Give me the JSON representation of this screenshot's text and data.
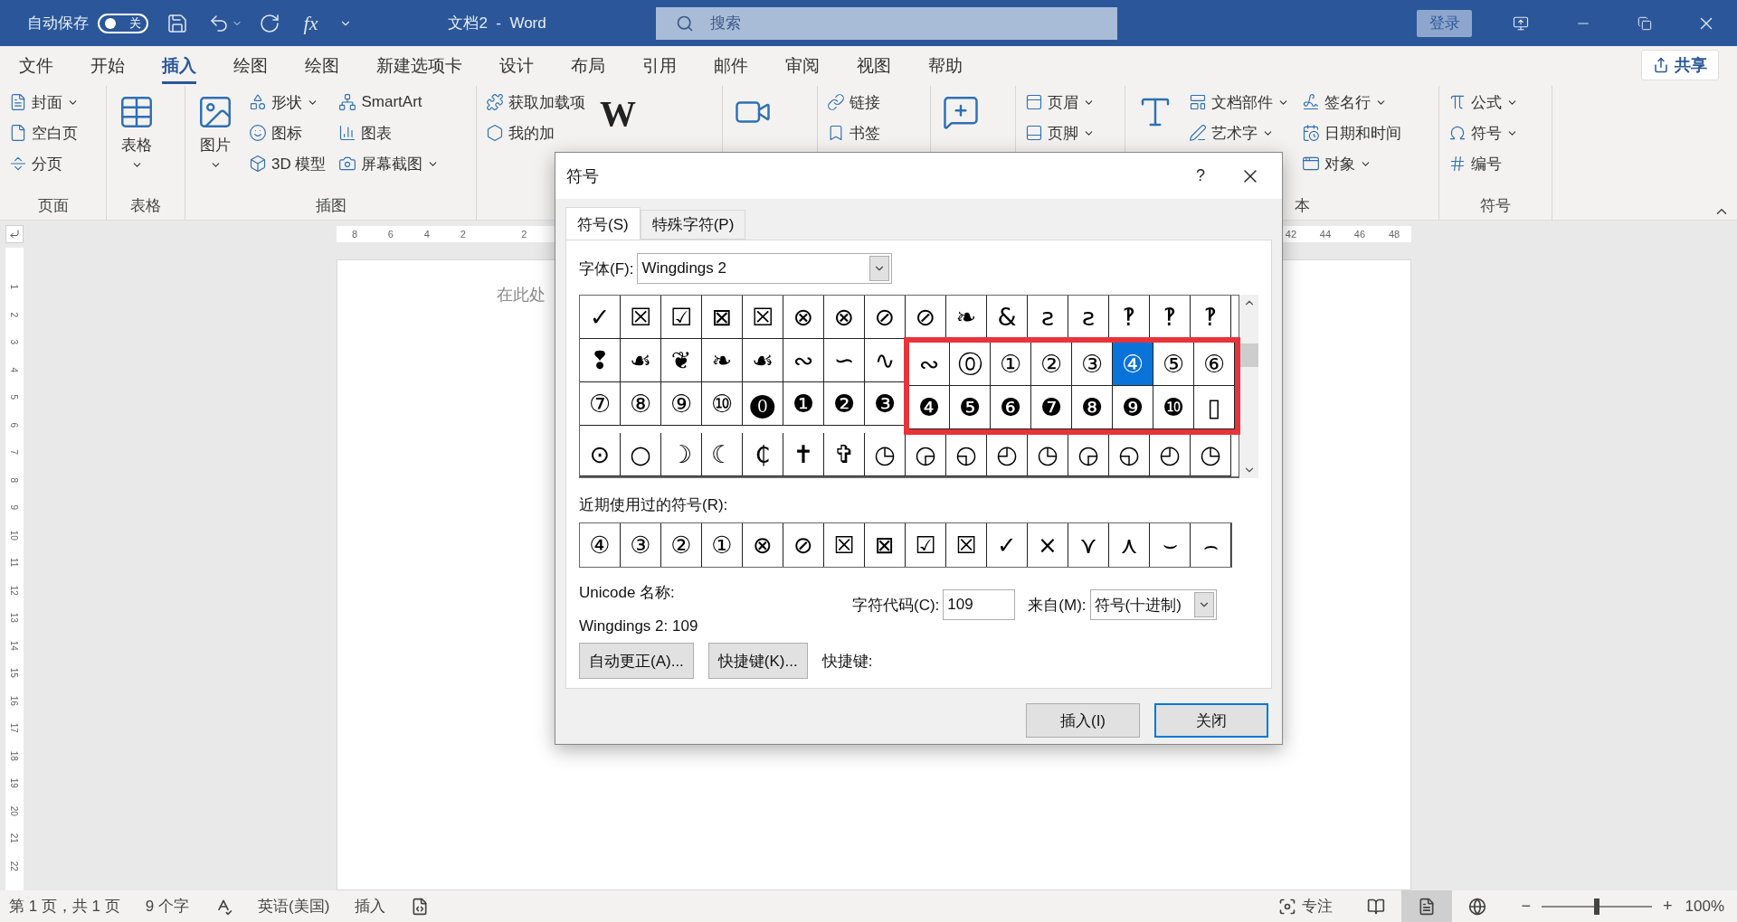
{
  "title_bar": {
    "autosave": {
      "label": "自动保存",
      "on": false,
      "state_text": "关"
    },
    "formula_text": "fx",
    "title": "文档2  -  Word",
    "search": {
      "placeholder": "搜索"
    },
    "sign_in": "登录"
  },
  "menu_tabs": [
    {
      "label": "文件",
      "selected": false
    },
    {
      "label": "开始",
      "selected": false
    },
    {
      "label": "插入",
      "selected": true
    },
    {
      "label": "绘图",
      "selected": false
    },
    {
      "label": "绘图",
      "selected": false
    },
    {
      "label": "新建选项卡",
      "selected": false
    },
    {
      "label": "设计",
      "selected": false
    },
    {
      "label": "布局",
      "selected": false
    },
    {
      "label": "引用",
      "selected": false
    },
    {
      "label": "邮件",
      "selected": false
    },
    {
      "label": "审阅",
      "selected": false
    },
    {
      "label": "视图",
      "selected": false
    },
    {
      "label": "帮助",
      "selected": false
    }
  ],
  "share": "共享",
  "ribbon_groups": [
    {
      "label": "页面",
      "columns": [
        [
          {
            "kind": "small",
            "label": "封面",
            "dropdown": true
          },
          {
            "kind": "small",
            "label": "空白页",
            "dropdown": false
          },
          {
            "kind": "small",
            "label": "分页",
            "dropdown": false
          }
        ]
      ]
    },
    {
      "label": "表格",
      "columns": [
        [
          {
            "kind": "large",
            "label": "表格",
            "dropdown": true
          }
        ]
      ]
    },
    {
      "label": "插图",
      "columns": [
        [
          {
            "kind": "large",
            "label": "图片",
            "dropdown": true
          }
        ],
        [
          {
            "kind": "small",
            "label": "形状",
            "dropdown": true
          },
          {
            "kind": "small",
            "label": "图标",
            "dropdown": false
          },
          {
            "kind": "small",
            "label": "3D 模型",
            "dropdown": false
          }
        ],
        [
          {
            "kind": "small",
            "label": "SmartArt",
            "dropdown": false
          },
          {
            "kind": "small",
            "label": "图表",
            "dropdown": false
          },
          {
            "kind": "small",
            "label": "屏幕截图",
            "dropdown": true
          }
        ]
      ]
    },
    {
      "columns": [
        [
          {
            "kind": "small",
            "label": "获取加载项",
            "dropdown": false
          },
          {
            "kind": "small",
            "label": "我的加",
            "dropdown": false
          }
        ],
        [
          {
            "kind": "large",
            "glyph": "W",
            "dropdown": false
          }
        ]
      ]
    },
    {
      "columns": [
        [
          {
            "kind": "large",
            "dropdown": false
          }
        ]
      ]
    },
    {
      "columns": [
        [
          {
            "kind": "small",
            "label": "链接",
            "dropdown": false
          },
          {
            "kind": "small",
            "label": "书签",
            "dropdown": false
          }
        ]
      ]
    },
    {
      "columns": [
        [
          {
            "kind": "large",
            "dropdown": false
          }
        ]
      ]
    },
    {
      "columns": [
        [
          {
            "kind": "small",
            "label": "页眉",
            "dropdown": true
          },
          {
            "kind": "small",
            "label": "页脚",
            "dropdown": true
          }
        ]
      ]
    },
    {
      "label": "本",
      "columns": [
        [
          {
            "kind": "large",
            "dropdown": false
          }
        ],
        [
          {
            "kind": "small",
            "label": "文档部件",
            "dropdown": true
          },
          {
            "kind": "small",
            "label": "艺术字",
            "dropdown": true
          }
        ],
        [
          {
            "kind": "small",
            "label": "签名行",
            "dropdown": true
          },
          {
            "kind": "small",
            "label": "日期和时间",
            "dropdown": false
          },
          {
            "kind": "small",
            "label": "对象",
            "dropdown": true
          }
        ]
      ]
    },
    {
      "label": "符号",
      "columns": [
        [
          {
            "kind": "small",
            "label": "公式",
            "dropdown": true
          },
          {
            "kind": "small",
            "label": "符号",
            "dropdown": true
          },
          {
            "kind": "small",
            "label": "编号",
            "dropdown": false
          }
        ]
      ]
    }
  ],
  "ruler": {
    "left_numbers": [
      "8",
      "6",
      "4",
      "2"
    ],
    "after_indent": [
      "2"
    ],
    "right_numbers": [
      "42",
      "44",
      "46",
      "48"
    ]
  },
  "vertical_ruler": [
    "1",
    "2",
    "3",
    "4",
    "5",
    "6",
    "7",
    "8",
    "9",
    "10",
    "11",
    "12",
    "13",
    "14",
    "15",
    "16",
    "17",
    "18",
    "19",
    "20",
    "21",
    "22"
  ],
  "document": {
    "placeholder_text": "在此处"
  },
  "dialog": {
    "title": "符号",
    "help": "?",
    "tabs": [
      {
        "label": "符号(S)",
        "selected": true
      },
      {
        "label": "特殊字符(P)",
        "selected": false
      }
    ],
    "font_label": "字体(F):",
    "font": "Wingdings 2",
    "symbol_rows": [
      {
        "cells": [
          {
            "glyph": "✓",
            "selected": false
          },
          {
            "glyph": "☒",
            "selected": false
          },
          {
            "glyph": "☑",
            "selected": false
          },
          {
            "glyph": "⊠",
            "selected": false
          },
          {
            "glyph": "☒",
            "selected": false
          },
          {
            "glyph": "⊗",
            "selected": false
          },
          {
            "glyph": "⊗",
            "selected": false
          },
          {
            "glyph": "⊘",
            "selected": false
          },
          {
            "glyph": "⊘",
            "selected": false
          },
          {
            "glyph": "❧",
            "selected": false
          },
          {
            "glyph": "&",
            "selected": false
          },
          {
            "glyph": "ƨ",
            "selected": false
          },
          {
            "glyph": "ƨ",
            "selected": false
          },
          {
            "glyph": "‽",
            "selected": false
          },
          {
            "glyph": "‽",
            "selected": false
          },
          {
            "glyph": "‽",
            "selected": false
          }
        ]
      },
      {
        "cells": [
          {
            "glyph": "❢",
            "selected": false
          },
          {
            "glyph": "☙",
            "selected": false
          },
          {
            "glyph": "❦",
            "selected": false
          },
          {
            "glyph": "❧",
            "selected": false
          },
          {
            "glyph": "☙",
            "selected": false
          },
          {
            "glyph": "∾",
            "selected": false
          },
          {
            "glyph": "∽",
            "selected": false
          },
          {
            "glyph": "∿",
            "selected": false
          },
          {
            "glyph": "∾",
            "selected": false
          },
          {
            "glyph": "⓪",
            "selected": false
          },
          {
            "glyph": "①",
            "selected": false
          },
          {
            "glyph": "②",
            "selected": false
          },
          {
            "glyph": "③",
            "selected": false
          },
          {
            "glyph": "④",
            "selected": true
          },
          {
            "glyph": "⑤",
            "selected": false
          },
          {
            "glyph": "⑥",
            "selected": false
          }
        ]
      },
      {
        "cells": [
          {
            "glyph": "⑦",
            "selected": false
          },
          {
            "glyph": "⑧",
            "selected": false
          },
          {
            "glyph": "⑨",
            "selected": false
          },
          {
            "glyph": "⑩",
            "selected": false
          },
          {
            "glyph": "⓿",
            "selected": false
          },
          {
            "glyph": "❶",
            "selected": false
          },
          {
            "glyph": "❷",
            "selected": false
          },
          {
            "glyph": "❸",
            "selected": false
          },
          {
            "glyph": "❹",
            "selected": false
          },
          {
            "glyph": "❺",
            "selected": false
          },
          {
            "glyph": "❻",
            "selected": false
          },
          {
            "glyph": "❼",
            "selected": false
          },
          {
            "glyph": "❽",
            "selected": false
          },
          {
            "glyph": "❾",
            "selected": false
          },
          {
            "glyph": "❿",
            "selected": false
          },
          {
            "glyph": "▯",
            "selected": false
          }
        ]
      },
      {
        "cells": [
          {
            "glyph": "⊙",
            "selected": false
          },
          {
            "glyph": "○",
            "selected": false
          },
          {
            "glyph": "☽",
            "selected": false
          },
          {
            "glyph": "☾",
            "selected": false
          },
          {
            "glyph": "₵",
            "selected": false
          },
          {
            "glyph": "✝",
            "selected": false
          },
          {
            "glyph": "✞",
            "selected": false
          },
          {
            "glyph": "◷",
            "selected": false
          },
          {
            "glyph": "◶",
            "selected": false
          },
          {
            "glyph": "◵",
            "selected": false
          },
          {
            "glyph": "◴",
            "selected": false
          },
          {
            "glyph": "◷",
            "selected": false
          },
          {
            "glyph": "◶",
            "selected": false
          },
          {
            "glyph": "◵",
            "selected": false
          },
          {
            "glyph": "◴",
            "selected": false
          },
          {
            "glyph": "◷",
            "selected": false
          }
        ]
      }
    ],
    "recent_label": "近期使用过的符号(R):",
    "recent": [
      "④",
      "③",
      "②",
      "①",
      "⊗",
      "⊘",
      "☒",
      "⊠",
      "☑",
      "☒",
      "✓",
      "×",
      "⋎",
      "⋏",
      "⌣",
      "⌢"
    ],
    "unicode_name_label": "Unicode 名称:",
    "unicode_value": "Wingdings 2: 109",
    "char_code_label": "字符代码(C):",
    "char_code": "109",
    "from_label": "来自(M):",
    "from": "符号(十进制)",
    "buttons": [
      "自动更正(A)...",
      "快捷键(K)..."
    ],
    "shortcut_label": "快捷键:",
    "footer_buttons": [
      {
        "label": "插入(I)",
        "focused": false
      },
      {
        "label": "关闭",
        "focused": true
      }
    ]
  },
  "status_bar": {
    "page": "第 1 页，共 1 页",
    "words": "9 个字",
    "language": "英语(美国)",
    "mode": "插入",
    "focus": "专注",
    "views": [
      {
        "selected": false
      },
      {
        "selected": true
      },
      {
        "selected": false
      }
    ],
    "zoom": {
      "minus": "−",
      "level": 0.5,
      "plus": "+",
      "reading": "100%"
    }
  }
}
